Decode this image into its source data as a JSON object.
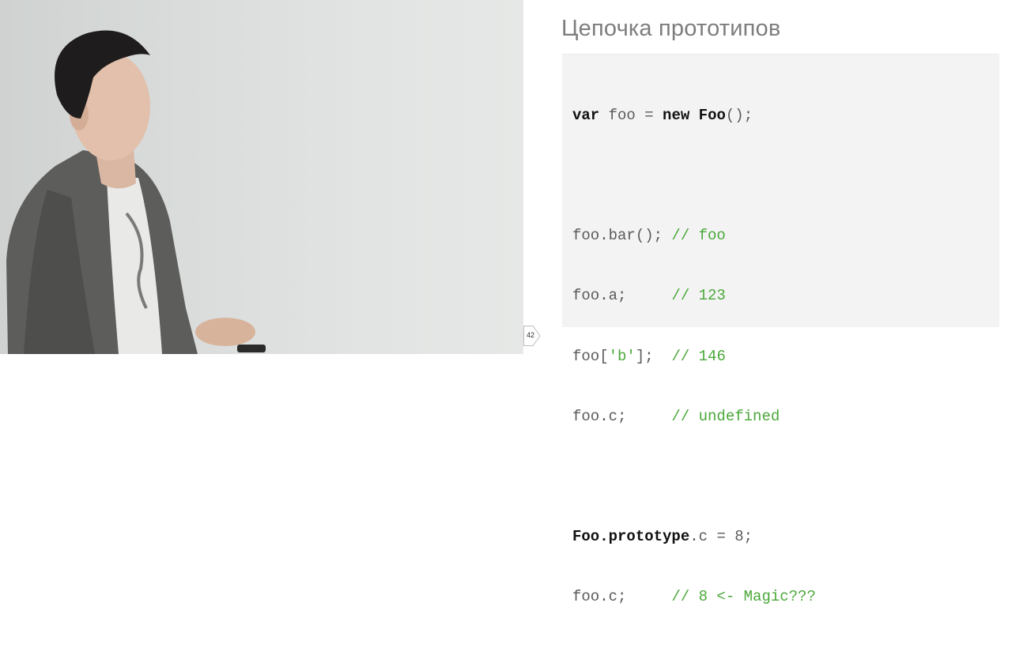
{
  "slide": {
    "title": "Цепочка прототипов",
    "page_number": "42"
  },
  "code": {
    "line1": {
      "kw1": "var",
      "t1": " foo = ",
      "kw2": "new",
      "t2": " ",
      "kw3": "Foo",
      "t3": "();"
    },
    "line3": {
      "code": "foo.bar(); ",
      "comment": "// foo"
    },
    "line4": {
      "code": "foo.a;     ",
      "comment": "// 123"
    },
    "line5": {
      "t1": "foo[",
      "str": "'b'",
      "t2": "];  ",
      "comment": "// 146"
    },
    "line6": {
      "code": "foo.c;     ",
      "comment": "// undefined"
    },
    "line8": {
      "kw1": "Foo.prototype",
      "t1": ".c = 8;"
    },
    "line9": {
      "code": "foo.c;     ",
      "comment": "// 8 <- Magic???"
    }
  },
  "colors": {
    "comment": "#4aa83a",
    "keyword": "#111111",
    "code": "#5a5a5a",
    "title": "#7d7d7d",
    "code_bg": "#f3f3f3"
  }
}
